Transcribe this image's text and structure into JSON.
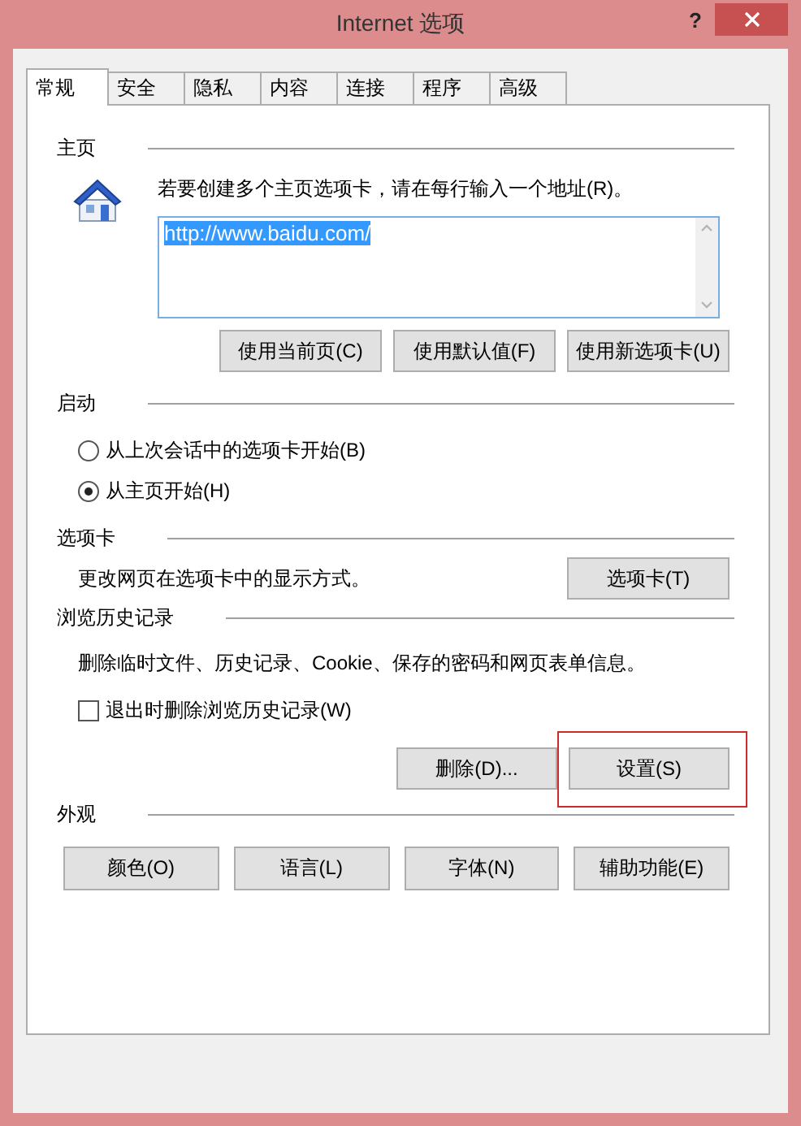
{
  "window": {
    "title": "Internet 选项",
    "help": "?"
  },
  "tabs": [
    {
      "label": "常规",
      "selected": true
    },
    {
      "label": "安全",
      "selected": false
    },
    {
      "label": "隐私",
      "selected": false
    },
    {
      "label": "内容",
      "selected": false
    },
    {
      "label": "连接",
      "selected": false
    },
    {
      "label": "程序",
      "selected": false
    },
    {
      "label": "高级",
      "selected": false
    }
  ],
  "home_page": {
    "heading": "主页",
    "instruction": "若要创建多个主页选项卡，请在每行输入一个地址(R)。",
    "url": "http://www.baidu.com/",
    "buttons": [
      {
        "label": "使用当前页(C)"
      },
      {
        "label": "使用默认值(F)"
      },
      {
        "label": "使用新选项卡(U)"
      }
    ]
  },
  "startup": {
    "heading": "启动",
    "options": [
      {
        "label": "从上次会话中的选项卡开始(B)",
        "selected": false
      },
      {
        "label": "从主页开始(H)",
        "selected": true
      }
    ]
  },
  "tabs_section": {
    "heading": "选项卡",
    "description": "更改网页在选项卡中的显示方式。",
    "button": "选项卡(T)"
  },
  "history": {
    "heading": "浏览历史记录",
    "description": "删除临时文件、历史记录、Cookie、保存的密码和网页表单信息。",
    "checkbox": {
      "label": "退出时删除浏览历史记录(W)",
      "checked": false
    },
    "buttons": [
      {
        "label": "删除(D)...",
        "highlighted": false
      },
      {
        "label": "设置(S)",
        "highlighted": true
      }
    ]
  },
  "appearance": {
    "heading": "外观",
    "buttons": [
      {
        "label": "颜色(O)"
      },
      {
        "label": "语言(L)"
      },
      {
        "label": "字体(N)"
      },
      {
        "label": "辅助功能(E)"
      }
    ]
  }
}
